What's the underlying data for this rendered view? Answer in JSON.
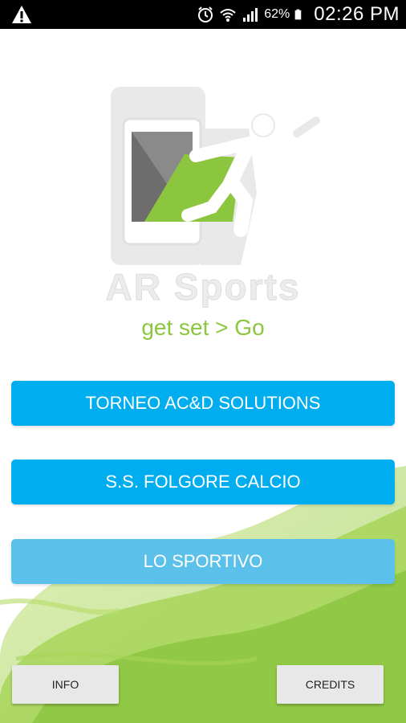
{
  "status_bar": {
    "battery_percent": "62%",
    "time": "02:26 PM",
    "icons": [
      "warning-icon",
      "alarm-icon",
      "wifi-icon",
      "signal-icon",
      "battery-icon"
    ]
  },
  "logo": {
    "brand_name": "AR Sports",
    "tagline": "get set > Go"
  },
  "menu": {
    "items": [
      {
        "label": "TORNEO AC&D SOLUTIONS"
      },
      {
        "label": "S.S. FOLGORE CALCIO"
      },
      {
        "label": "LO SPORTIVO"
      }
    ]
  },
  "footer": {
    "info_label": "INFO",
    "credits_label": "CREDITS"
  },
  "colors": {
    "button_blue": "#00aeef",
    "button_blue_light": "#5bc0ea",
    "accent_green": "#8cc63f"
  }
}
